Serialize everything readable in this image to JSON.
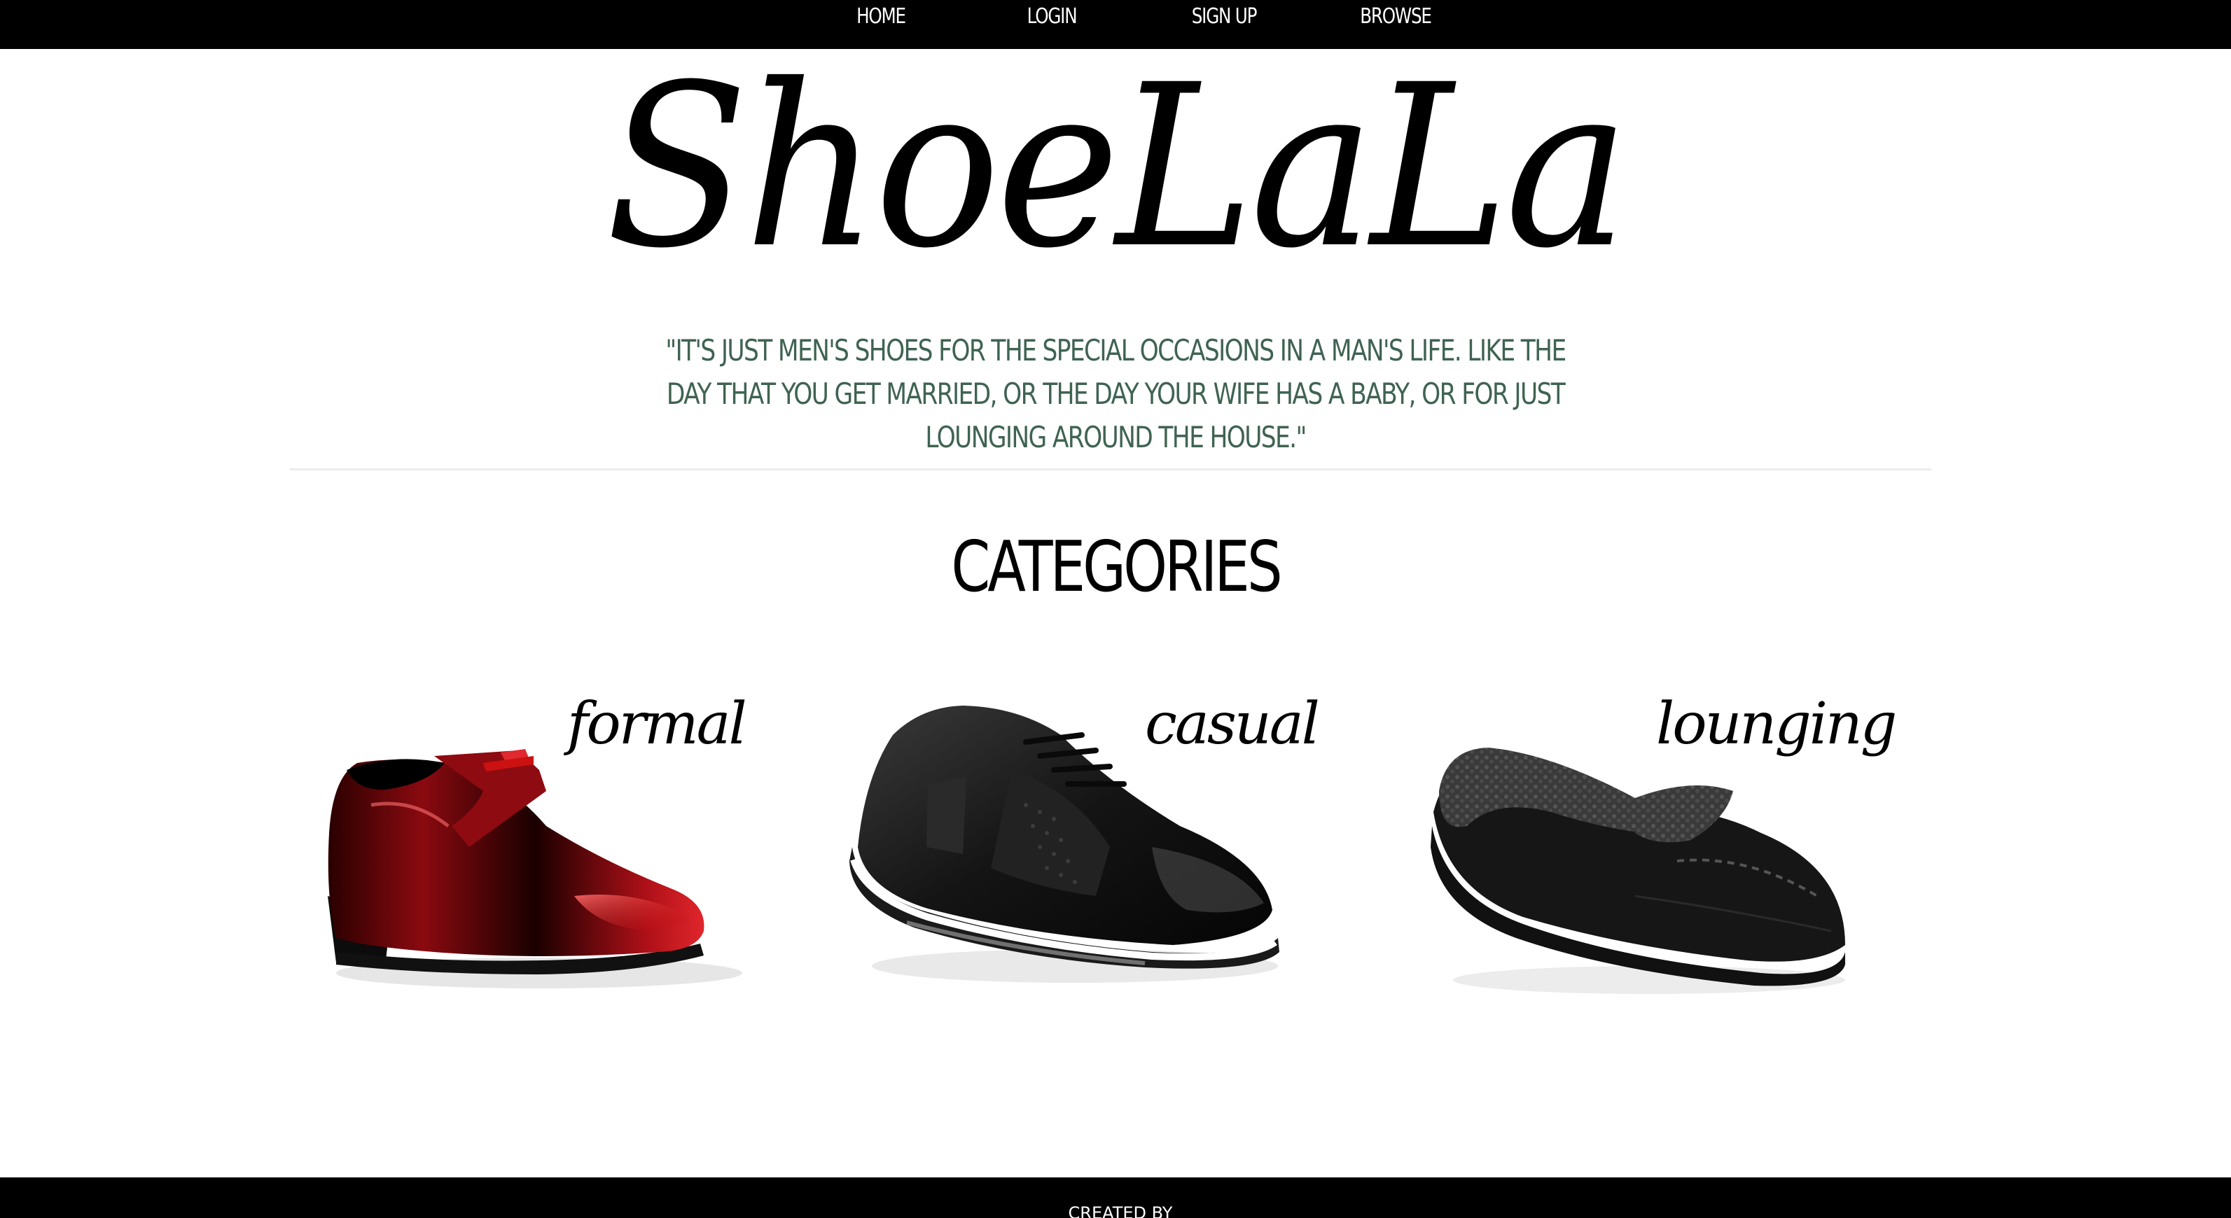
{
  "nav": {
    "items": [
      {
        "label": "HOME"
      },
      {
        "label": "LOGIN"
      },
      {
        "label": "SIGN UP"
      },
      {
        "label": "BROWSE"
      }
    ]
  },
  "brand": {
    "logo_text": "ShoeLaLa"
  },
  "tagline": "\"IT'S JUST MEN'S SHOES FOR THE SPECIAL OCCASIONS IN A MAN'S LIFE. LIKE THE DAY THAT YOU GET MARRIED, OR THE DAY YOUR WIFE HAS A BABY, OR FOR JUST LOUNGING AROUND THE HOUSE.\"",
  "categories": {
    "heading": "CATEGORIES",
    "items": [
      {
        "label": "formal",
        "image": "red-black-patent-oxford-shoe"
      },
      {
        "label": "casual",
        "image": "black-leather-sneaker"
      },
      {
        "label": "lounging",
        "image": "black-sherpa-moccasin-slipper"
      }
    ]
  },
  "footer": {
    "credit": "CREATED BY"
  },
  "colors": {
    "nav_bg": "#000000",
    "tagline": "#3f6352",
    "divider": "#ececec",
    "formal_accent": "#c0101a"
  }
}
